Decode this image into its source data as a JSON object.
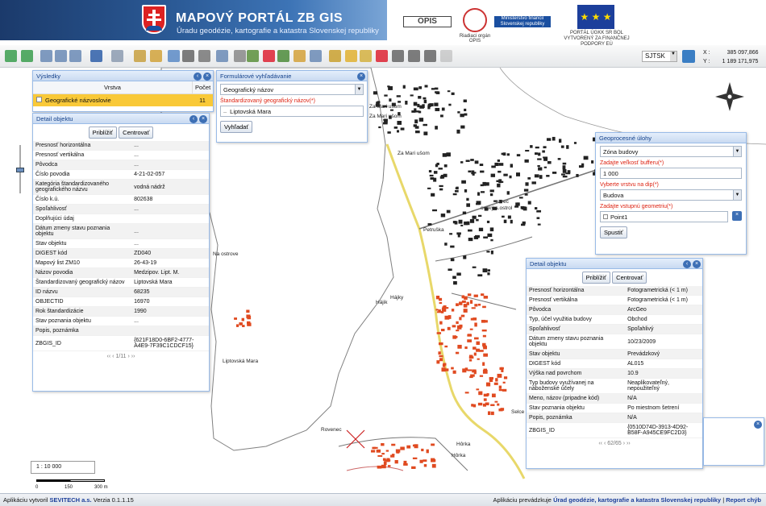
{
  "header": {
    "title": "MAPOVÝ PORTÁL ZB GIS",
    "subtitle": "Úradu geodézie, kartografie a katastra Slovenskej republiky",
    "logos": {
      "opis": "OPIS",
      "seal_caption": "Riadiaci orgán OPIS",
      "minfin": "Ministerstvo financií Slovenskej republiky",
      "eu_caption": "PORTÁL ÚGKK SR BOL VYTVORENÝ ZA FINANČNEJ PODPORY EÚ"
    }
  },
  "toolbar": {
    "crs_value": "SJTSK",
    "coords": {
      "x_label": "X :",
      "x_value": "385 097,866",
      "y_label": "Y :",
      "y_value": "1 189 171,975"
    }
  },
  "results_panel": {
    "title": "Výsledky",
    "col_layer": "Vrstva",
    "col_count": "Počet",
    "rows": [
      {
        "layer": "Geografické názvoslovie",
        "count": "11"
      }
    ]
  },
  "detail_left": {
    "title": "Detail objektu",
    "zoom_btn": "Priblížiť",
    "center_btn": "Centrovať",
    "rows": [
      {
        "k": "Presnosť horizontálna",
        "v": "..."
      },
      {
        "k": "Presnosť vertikálna",
        "v": "..."
      },
      {
        "k": "Pôvodca",
        "v": "..."
      },
      {
        "k": "Číslo povodia",
        "v": "4-21-02-057"
      },
      {
        "k": "Kategória štandardizovaného geografického názvu",
        "v": "vodná nádrž"
      },
      {
        "k": "Číslo k.ú.",
        "v": "802638"
      },
      {
        "k": "Spoľahlivosť",
        "v": "..."
      },
      {
        "k": "Doplňujúci údaj",
        "v": ""
      },
      {
        "k": "Dátum zmeny stavu poznania objektu",
        "v": "..."
      },
      {
        "k": "Stav objektu",
        "v": "..."
      },
      {
        "k": "DIGEST kód",
        "v": "ZD040"
      },
      {
        "k": "Mapový list ZM10",
        "v": "26-43-19"
      },
      {
        "k": "Názov povodia",
        "v": "Medzipov. Lipt. M."
      },
      {
        "k": "Štandardizovaný geografický názov",
        "v": "Liptovská Mara"
      },
      {
        "k": "ID názvu",
        "v": "68235"
      },
      {
        "k": "OBJECTID",
        "v": "16970"
      },
      {
        "k": "Rok štandardizácie",
        "v": "1990"
      },
      {
        "k": "Stav poznania objektu",
        "v": "..."
      },
      {
        "k": "Popis, poznámka",
        "v": ""
      },
      {
        "k": "ZBGIS_ID",
        "v": "{621F18D0-6BF2-4777-A4E9-7F39C1CDCF15}"
      }
    ],
    "pager": "1/11"
  },
  "form_panel": {
    "title": "Formulárové vyhľadávanie",
    "select_value": "Geografický názov",
    "field_label": "Štandardizovaný geografický názov(*)",
    "field_value": "Liptovská Mara",
    "search_btn": "Vyhľadať"
  },
  "geo_panel": {
    "title": "Geoprocesné úlohy",
    "task_value": "Zóna budovy",
    "buffer_label": "Zadajte veľkosť bufferu(*)",
    "buffer_value": "1 000",
    "layer_label": "Vyberte vrstvu na dip(*)",
    "layer_value": "Budova",
    "geom_label": "Zadajte vstupnú geometriu(*)",
    "geom_value": "Point1",
    "run_btn": "Spustiť"
  },
  "detail_right": {
    "title": "Detail objektu",
    "zoom_btn": "Priblížiť",
    "center_btn": "Centrovať",
    "rows": [
      {
        "k": "Presnosť horizontálna",
        "v": "Fotogrametrická (< 1 m)"
      },
      {
        "k": "Presnosť vertikálna",
        "v": "Fotogrametrická (< 1 m)"
      },
      {
        "k": "Pôvodca",
        "v": "ArcGeo"
      },
      {
        "k": "Typ, účel využitia budovy",
        "v": "Obchod"
      },
      {
        "k": "Spoľahlivosť",
        "v": "Spoľahlivý"
      },
      {
        "k": "Dátum zmeny stavu poznania objektu",
        "v": "10/23/2009"
      },
      {
        "k": "Stav objektu",
        "v": "Prevádzkový"
      },
      {
        "k": "DIGEST kód",
        "v": "AL015"
      },
      {
        "k": "Výška nad povrchom",
        "v": "10.9"
      },
      {
        "k": "Typ budovy využívanej na náboženské účely",
        "v": "Neaplikovateľný, nepoužiteľný"
      },
      {
        "k": "Meno, názov (pripadne kód)",
        "v": "N/A"
      },
      {
        "k": "Stav poznania objektu",
        "v": "Po miestnom šetrení"
      },
      {
        "k": "Popis, poznámka",
        "v": "N/A"
      },
      {
        "k": "ZBGIS_ID",
        "v": "{0510D74D-3913-4D92-B58F-A945CE9FC2D3}"
      }
    ],
    "pager": "62/65"
  },
  "map_labels": [
    {
      "text": "Za Mari ušom"
    },
    {
      "text": "Za Mari ušom"
    },
    {
      "text": "Za Mari ušom"
    },
    {
      "text": "Petruška"
    },
    {
      "text": "Na ostrove"
    },
    {
      "text": "Hájik"
    },
    {
      "text": "Hájky"
    },
    {
      "text": "Liptovská Mara"
    },
    {
      "text": "Rovenec"
    },
    {
      "text": "Hôrka"
    },
    {
      "text": "Hôrka"
    },
    {
      "text": "Selce"
    },
    {
      "text": "rovec"
    },
    {
      "text": "ovský s.ostrol"
    }
  ],
  "scale": {
    "ratio": "1 : 10 000",
    "t0": "0",
    "t1": "150",
    "t2": "300 m"
  },
  "status": {
    "left_prefix": "Aplikáciu vytvoril",
    "left_company": "SEVITECH a.s.",
    "left_version": "Verzia 0.1.1.15",
    "right_prefix": "Aplikáciu prevádzkuje",
    "right_org": "Úrad geodézie, kartografie a katastra Slovenskej republiky",
    "right_sep": "|",
    "right_link": "Report chýb"
  },
  "colors": {
    "header_blue": "#1b3a6b",
    "selected_row": "#f9c938",
    "building_red": "#e04a20",
    "lake_border": "#7a7a7a",
    "road_yellow": "#e8d86a"
  }
}
